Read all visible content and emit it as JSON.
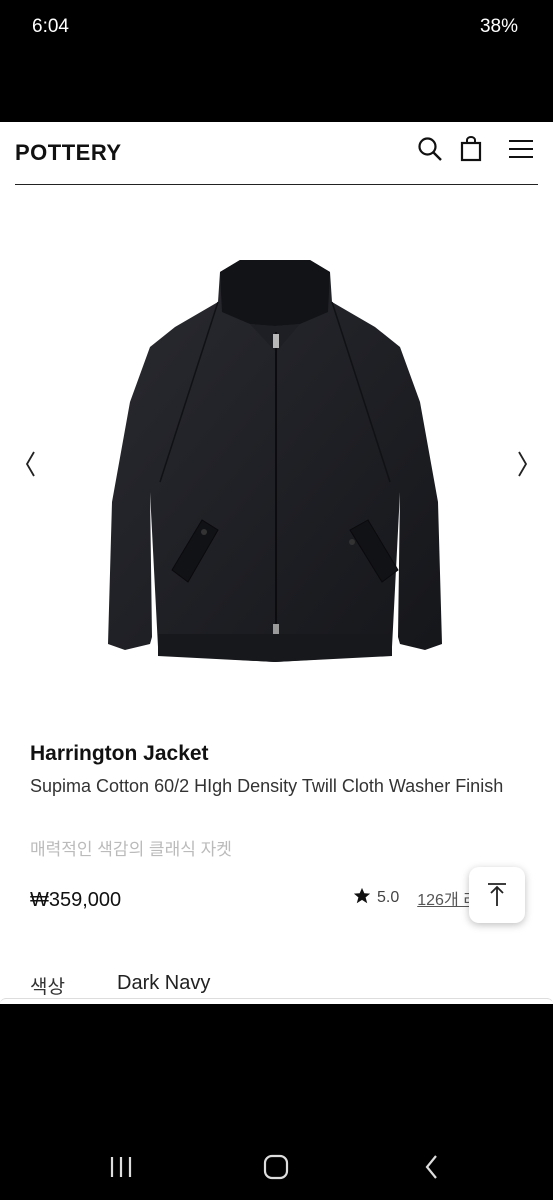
{
  "status_bar": {
    "time": "6:04",
    "battery": "38%"
  },
  "header": {
    "brand": "POTTERY",
    "icons": [
      "search-icon",
      "shopping-bag-icon",
      "menu-icon"
    ]
  },
  "product": {
    "name": "Harrington Jacket",
    "description": "Supima Cotton 60/2 HIgh Density Twill Cloth Washer Finish",
    "subtitle": "매력적인 색감의 클래식 자켓",
    "price": "₩359,000",
    "rating": "5.0",
    "reviews": "126개 리",
    "color_label": "색상",
    "color_value": "Dark Navy",
    "image_color": "#1c1d22"
  },
  "colors": {
    "accent": "#111111",
    "muted": "#bbbbbb"
  }
}
